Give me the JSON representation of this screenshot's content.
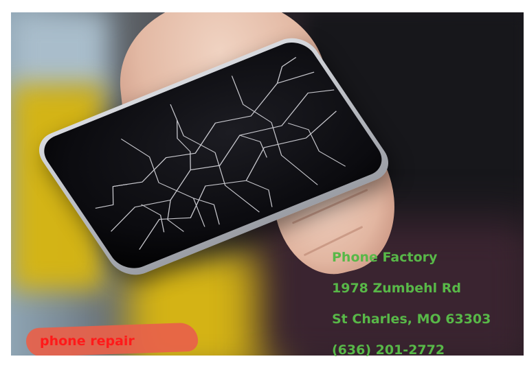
{
  "photo": {
    "subject": "hand-holding-cracked-phone"
  },
  "overlay": {
    "banner_label": "phone repair",
    "banner_color": "#e8614a",
    "banner_text_color": "#ff1a1a"
  },
  "address": {
    "business_name": "Phone Factory",
    "street": "1978 Zumbehl Rd",
    "city_state_zip": "St Charles, MO 63303",
    "phone": "(636) 201-2772",
    "text_color": "#58b848"
  }
}
